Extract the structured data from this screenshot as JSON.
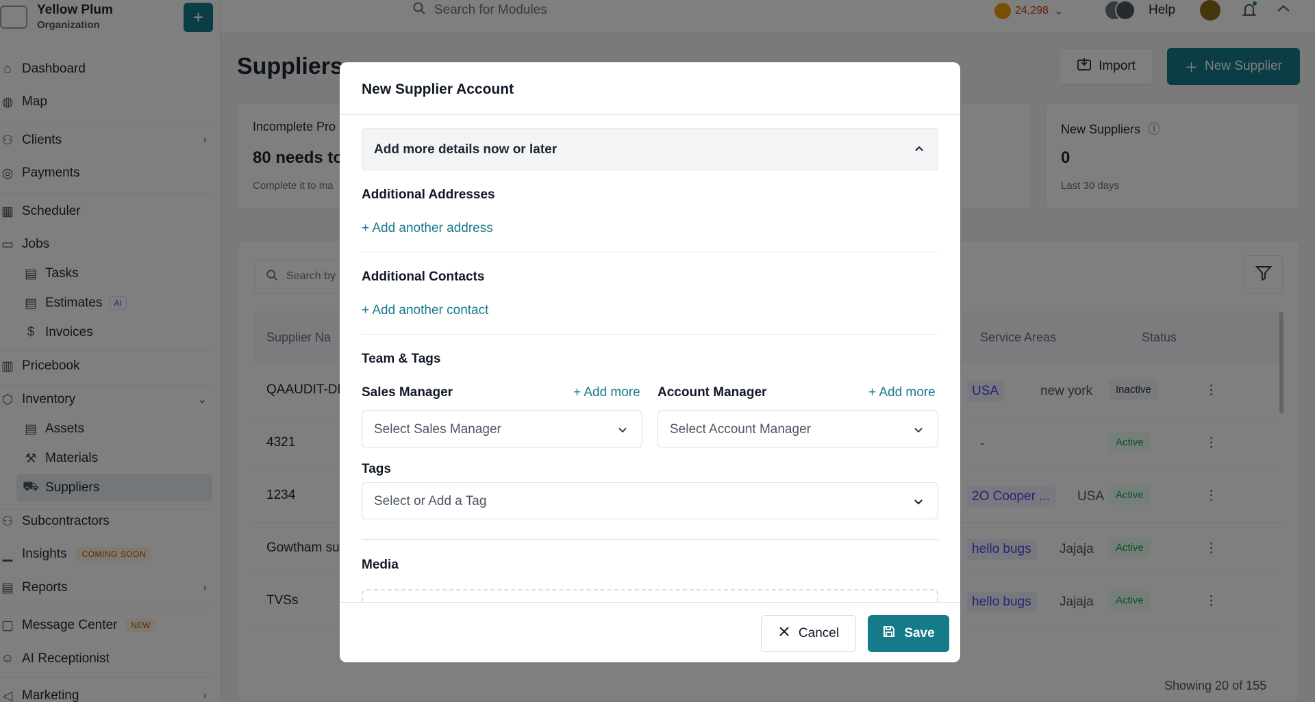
{
  "org": {
    "name": "Yellow Plum",
    "subtitle": "Organization",
    "add_label": "+"
  },
  "topbar": {
    "search_placeholder": "Search for Modules",
    "credits": "24,298",
    "help": "Help"
  },
  "sidebar": {
    "items": [
      {
        "label": "Dashboard"
      },
      {
        "label": "Map"
      },
      {
        "label": "Clients"
      },
      {
        "label": "Payments"
      },
      {
        "label": "Scheduler"
      },
      {
        "label": "Jobs"
      },
      {
        "label": "Tasks"
      },
      {
        "label": "Estimates",
        "badge": "AI"
      },
      {
        "label": "Invoices"
      },
      {
        "label": "Pricebook"
      },
      {
        "label": "Inventory"
      },
      {
        "label": "Assets"
      },
      {
        "label": "Materials"
      },
      {
        "label": "Suppliers"
      },
      {
        "label": "Subcontractors"
      },
      {
        "label": "Insights",
        "badge": "COMING SOON"
      },
      {
        "label": "Reports"
      },
      {
        "label": "Message Center",
        "badge": "NEW"
      },
      {
        "label": "AI Receptionist"
      },
      {
        "label": "Marketing"
      }
    ]
  },
  "page": {
    "title": "Suppliers",
    "import_label": "Import",
    "new_supplier_label": "New Supplier",
    "cards": [
      {
        "title": "Incomplete Pro",
        "value": "80 needs to",
        "sub": "Complete it to ma"
      },
      {
        "title": "New Suppliers",
        "value": "0",
        "sub": "Last 30 days"
      }
    ],
    "table": {
      "search_placeholder": "Search by",
      "headers": {
        "name": "Supplier Na",
        "areas": "Service Areas",
        "status": "Status"
      },
      "rows": [
        {
          "name": "QAAUDIT-DE",
          "area1": "USA",
          "area2": "new york",
          "status": "Inactive"
        },
        {
          "name": "4321",
          "area1": "",
          "area2": "-",
          "status": "Active"
        },
        {
          "name": "1234",
          "area1": "2O Cooper ...",
          "area2": "USA",
          "status": "Active"
        },
        {
          "name": "Gowtham su",
          "area1": "hello bugs",
          "area2": "Jajaja",
          "status": "Active"
        },
        {
          "name": "TVSs",
          "area1": "hello bugs",
          "area2": "Jajaja",
          "status": "Active"
        }
      ]
    },
    "showing": "Showing 20 of 155"
  },
  "modal": {
    "title": "New Supplier Account",
    "accordion_label": "Add more details now or later",
    "additional_addresses": "Additional Addresses",
    "add_address": "+ Add another address",
    "additional_contacts": "Additional Contacts",
    "add_contact": "+ Add another contact",
    "team_tags": "Team & Tags",
    "sales_manager": "Sales Manager",
    "sales_add_more": "+ Add more",
    "sales_placeholder": "Select Sales Manager",
    "account_manager": "Account Manager",
    "account_add_more": "+ Add more",
    "account_placeholder": "Select Account Manager",
    "tags_label": "Tags",
    "tags_placeholder": "Select or Add a Tag",
    "media_label": "Media",
    "cancel_label": "Cancel",
    "save_label": "Save"
  },
  "colors": {
    "accent": "#157a8a",
    "overlay": "rgba(0,0,0,0.5)"
  }
}
